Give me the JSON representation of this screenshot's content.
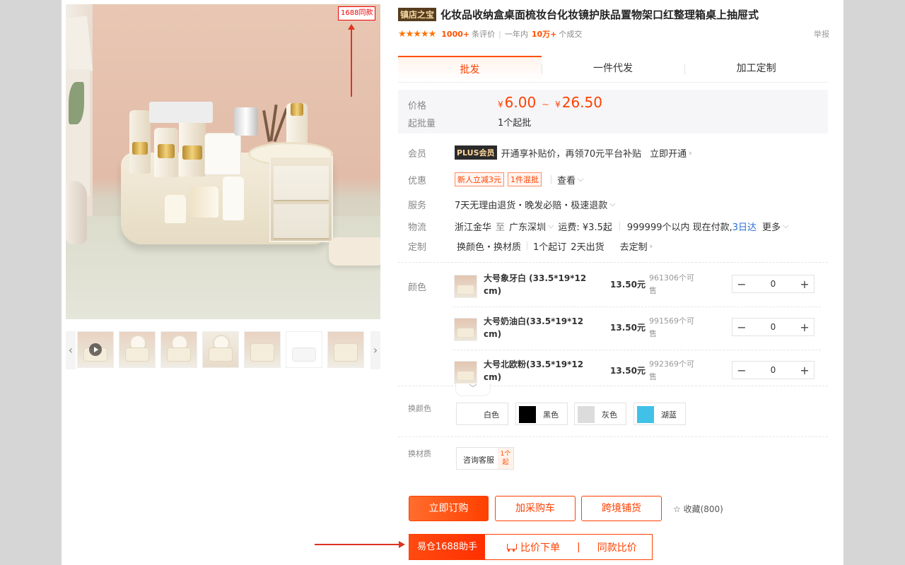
{
  "gallery": {
    "same_badge": "1688同款",
    "prev_arrow": "‹",
    "next_arrow": "›"
  },
  "product": {
    "shop_tag": "镇店之宝",
    "title": "化妆品收纳盒桌面梳妆台化妆镜护肤品置物架口红整理箱桌上抽屉式",
    "stars": "★★★★★",
    "review_count": "1000+",
    "review_label": "条评价",
    "year_label": "一年内",
    "deal_count": "10万+",
    "deal_label": "个成交",
    "report": "举报"
  },
  "tabs": [
    {
      "label": "批发",
      "active": true
    },
    {
      "label": "一件代发",
      "active": false
    },
    {
      "label": "加工定制",
      "active": false
    }
  ],
  "price": {
    "label": "价格",
    "currency": "¥",
    "min": "6.00",
    "tilde": "~",
    "max": "26.50",
    "moq_label": "起批量",
    "moq_value": "1个起批"
  },
  "info": {
    "member": {
      "label": "会员",
      "badge": "PLUS会员",
      "text": "开通享补贴价，再领70元平台补贴",
      "action": "立即开通"
    },
    "promo": {
      "label": "优惠",
      "tags": [
        "新人立减3元",
        "1件混批"
      ],
      "action": "查看"
    },
    "service": {
      "label": "服务",
      "text": "7天无理由退货・晚发必赔・极速退款"
    },
    "logistics": {
      "label": "物流",
      "from": "浙江金华",
      "to_word": "至",
      "to": "广东深圳",
      "fee": "运费: ¥3.5起",
      "stock": "999999个以内 现在付款,",
      "eta": "3日达",
      "more": "更多"
    },
    "custom": {
      "label": "定制",
      "types": "换颜色・换材质",
      "moq": "1个起订",
      "ship": "2天出货",
      "action": "去定制"
    }
  },
  "sku": {
    "label": "颜色",
    "items": [
      {
        "name": "大号象牙白 (33.5*19*12 cm)",
        "price": "13.50元",
        "stock": "961306个可售",
        "qty": "0"
      },
      {
        "name": "大号奶油白(33.5*19*12 cm)",
        "price": "13.50元",
        "stock": "991569个可售",
        "qty": "0"
      },
      {
        "name": "大号北欧粉(33.5*19*12 cm)",
        "price": "13.50元",
        "stock": "992369个可售",
        "qty": "0"
      }
    ],
    "minus": "−",
    "plus": "+",
    "expand": "﹀"
  },
  "custom_color": {
    "label": "换颜色",
    "options": [
      {
        "name": "白色",
        "color": "#ffffff"
      },
      {
        "name": "黑色",
        "color": "#000000"
      },
      {
        "name": "灰色",
        "color": "#dcdcdc"
      },
      {
        "name": "湖蓝",
        "color": "#41c1e8"
      }
    ]
  },
  "custom_material": {
    "label": "换材质",
    "option": "咨询客服",
    "min_badge": "1个起"
  },
  "actions": {
    "order": "立即订购",
    "cart": "加采购车",
    "cross": "跨境铺货",
    "fav": "☆ 收藏(800)"
  },
  "helper": {
    "brand": "易仓1688助手",
    "compare_order": "比价下单",
    "divider": "|",
    "same_compare": "同款比价"
  }
}
